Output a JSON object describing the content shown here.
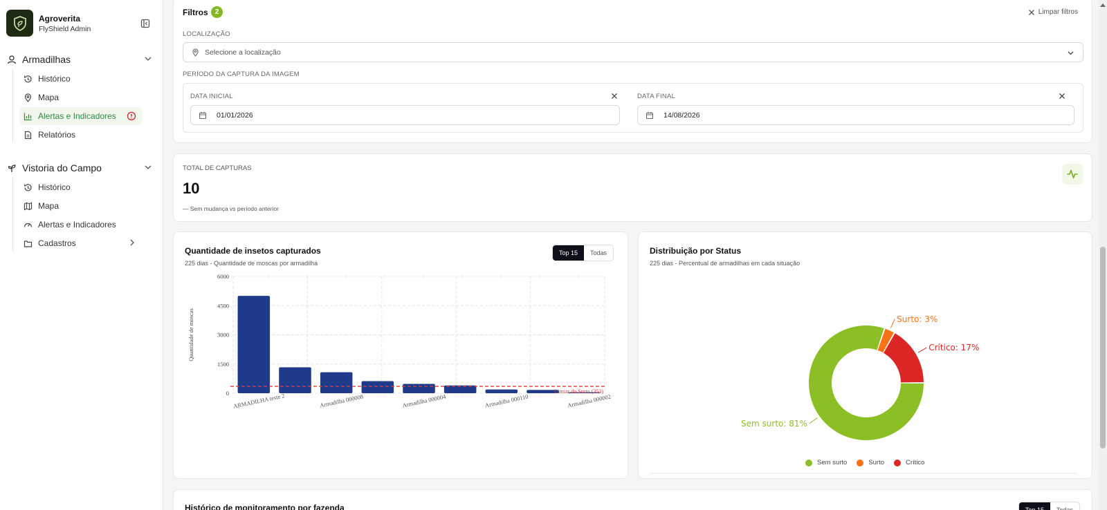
{
  "brand": {
    "name": "Agroverita",
    "subtitle": "FlyShield Admin"
  },
  "sidebar": {
    "sections": [
      {
        "label": "Armadilhas",
        "items": [
          {
            "label": "Histórico"
          },
          {
            "label": "Mapa"
          },
          {
            "label": "Alertas e Indicadores"
          },
          {
            "label": "Relatórios"
          }
        ]
      },
      {
        "label": "Vistoria do Campo",
        "items": [
          {
            "label": "Histórico"
          },
          {
            "label": "Mapa"
          },
          {
            "label": "Alertas e Indicadores"
          },
          {
            "label": "Cadastros"
          }
        ]
      }
    ]
  },
  "filters": {
    "title": "Filtros",
    "count": "2",
    "clear_label": "Limpar filtros",
    "location_label": "LOCALIZAÇÃO",
    "location_placeholder": "Selecione a localização",
    "period_label": "PERÍODO DA CAPTURA DA IMAGEM",
    "start_label": "DATA INICIAL",
    "start_value": "01/01/2026",
    "end_label": "DATA FINAL",
    "end_value": "14/08/2026"
  },
  "total": {
    "label": "TOTAL DE CAPTURAS",
    "value": "10",
    "change": "Sem mudança vs período anterior"
  },
  "bar_card": {
    "title": "Quantidade de insetos capturados",
    "subtitle": "225 dias - Quantidade de moscas por armadilha",
    "toggle": [
      "Top 15",
      "Todas"
    ]
  },
  "pie_card": {
    "title": "Distribuição por Status",
    "subtitle": "225 dias - Percentual de armadilhas em cada situação"
  },
  "history_card": {
    "title": "Histórico de monitoramento por fazenda"
  },
  "colors": {
    "bar": "#1f3a8a",
    "ok": "#8cbf26",
    "surto": "#f97316",
    "critico": "#dc2626",
    "active": "#2d8a3e"
  },
  "chart_data": [
    {
      "type": "bar",
      "ylabel": "Quantidade de moscas",
      "ylim": [
        0,
        6000
      ],
      "yticks": [
        0,
        1500,
        3000,
        4500,
        6000
      ],
      "categories": [
        "ARMADILHA teste 2",
        "",
        "Armadilha 000008",
        "",
        "Armadilha 000004",
        "",
        "Armadilha 000110",
        "",
        "Armadilha 000002"
      ],
      "values": [
        5000,
        1330,
        1080,
        620,
        480,
        400,
        190,
        170,
        50
      ],
      "threshold": {
        "value": 353,
        "label": "Limiar do Surto (353)"
      },
      "grid": true
    },
    {
      "type": "pie",
      "labels": [
        "Sem surto",
        "Surto",
        "Crítico"
      ],
      "values": [
        81,
        3,
        17
      ],
      "slice_labels": [
        "Sem surto: 81%",
        "Surto: 3%",
        "Crítico: 17%"
      ],
      "legend": "bottom"
    }
  ]
}
